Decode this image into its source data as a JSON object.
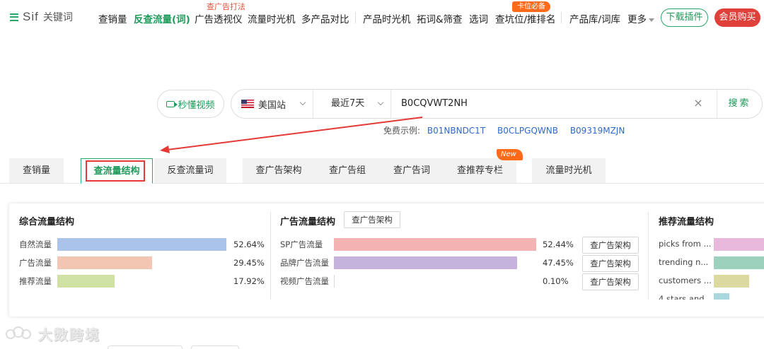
{
  "nav": {
    "logo_text": "Sif",
    "logo_sub": "关键词",
    "items": [
      {
        "label": "查销量"
      },
      {
        "label": "反查流量(词)"
      },
      {
        "label": "广告透视仪"
      },
      {
        "label": "流量时光机"
      },
      {
        "label": "多产品对比"
      },
      {
        "label": "产品时光机"
      },
      {
        "label": "拓词&筛查"
      },
      {
        "label": "选词"
      },
      {
        "label": "查坑位/推排名"
      },
      {
        "label": "产品库/词库"
      },
      {
        "label": "更多"
      }
    ],
    "above_label": "查广告打法",
    "badge_label": "卡位必备",
    "download_label": "下载插件",
    "vip_label": "会员购买"
  },
  "search": {
    "video_label": "秒懂视频",
    "site_label": "美国站",
    "range_label": "最近7天",
    "query": "B0CQVWT2NH",
    "clear_symbol": "×",
    "button_label": "搜索",
    "examples_label": "免费示例:",
    "examples": [
      "B01NBNDC1T",
      "B0CLPGQWNB",
      "B09319MZJN"
    ]
  },
  "tabs": [
    {
      "label": "查销量"
    },
    {
      "label": "查流量结构"
    },
    {
      "label": "反查流量词"
    },
    {
      "label": "查广告架构"
    },
    {
      "label": "查广告组"
    },
    {
      "label": "查广告词"
    },
    {
      "label": "查推荐专栏"
    },
    {
      "label": "流量时光机"
    }
  ],
  "new_badge": "New",
  "overall": {
    "title": "综合流量结构",
    "rows": [
      {
        "label": "自然流量",
        "pct_text": "52.64%",
        "value": 52.64,
        "color": "#a9c3ea"
      },
      {
        "label": "广告流量",
        "pct_text": "29.45%",
        "value": 29.45,
        "color": "#f3c5b3"
      },
      {
        "label": "推荐流量",
        "pct_text": "17.92%",
        "value": 17.92,
        "color": "#cfe2a3"
      }
    ]
  },
  "ads": {
    "title": "广告流量结构",
    "header_button": "查广告架构",
    "row_button": "查广告架构",
    "rows": [
      {
        "label": "SP广告流量",
        "pct_text": "52.44%",
        "value": 52.44,
        "color": "#f3b3b3"
      },
      {
        "label": "品牌广告流量",
        "pct_text": "47.45%",
        "value": 47.45,
        "color": "#c5b3dd"
      },
      {
        "label": "视频广告流量",
        "pct_text": "0.10%",
        "value": 0.1,
        "color": "#d9d9d9"
      }
    ]
  },
  "recommend": {
    "title": "推荐流量结构",
    "rows": [
      {
        "label": "picks from ...",
        "color": "#e8b9dd"
      },
      {
        "label": "trending n...",
        "color": "#9bd1bd"
      },
      {
        "label": "customers ...",
        "color": "#dcd9a0"
      },
      {
        "label": "4 stars and ...",
        "color": "#a9d9df"
      }
    ]
  },
  "watermark": "大数跨境"
}
